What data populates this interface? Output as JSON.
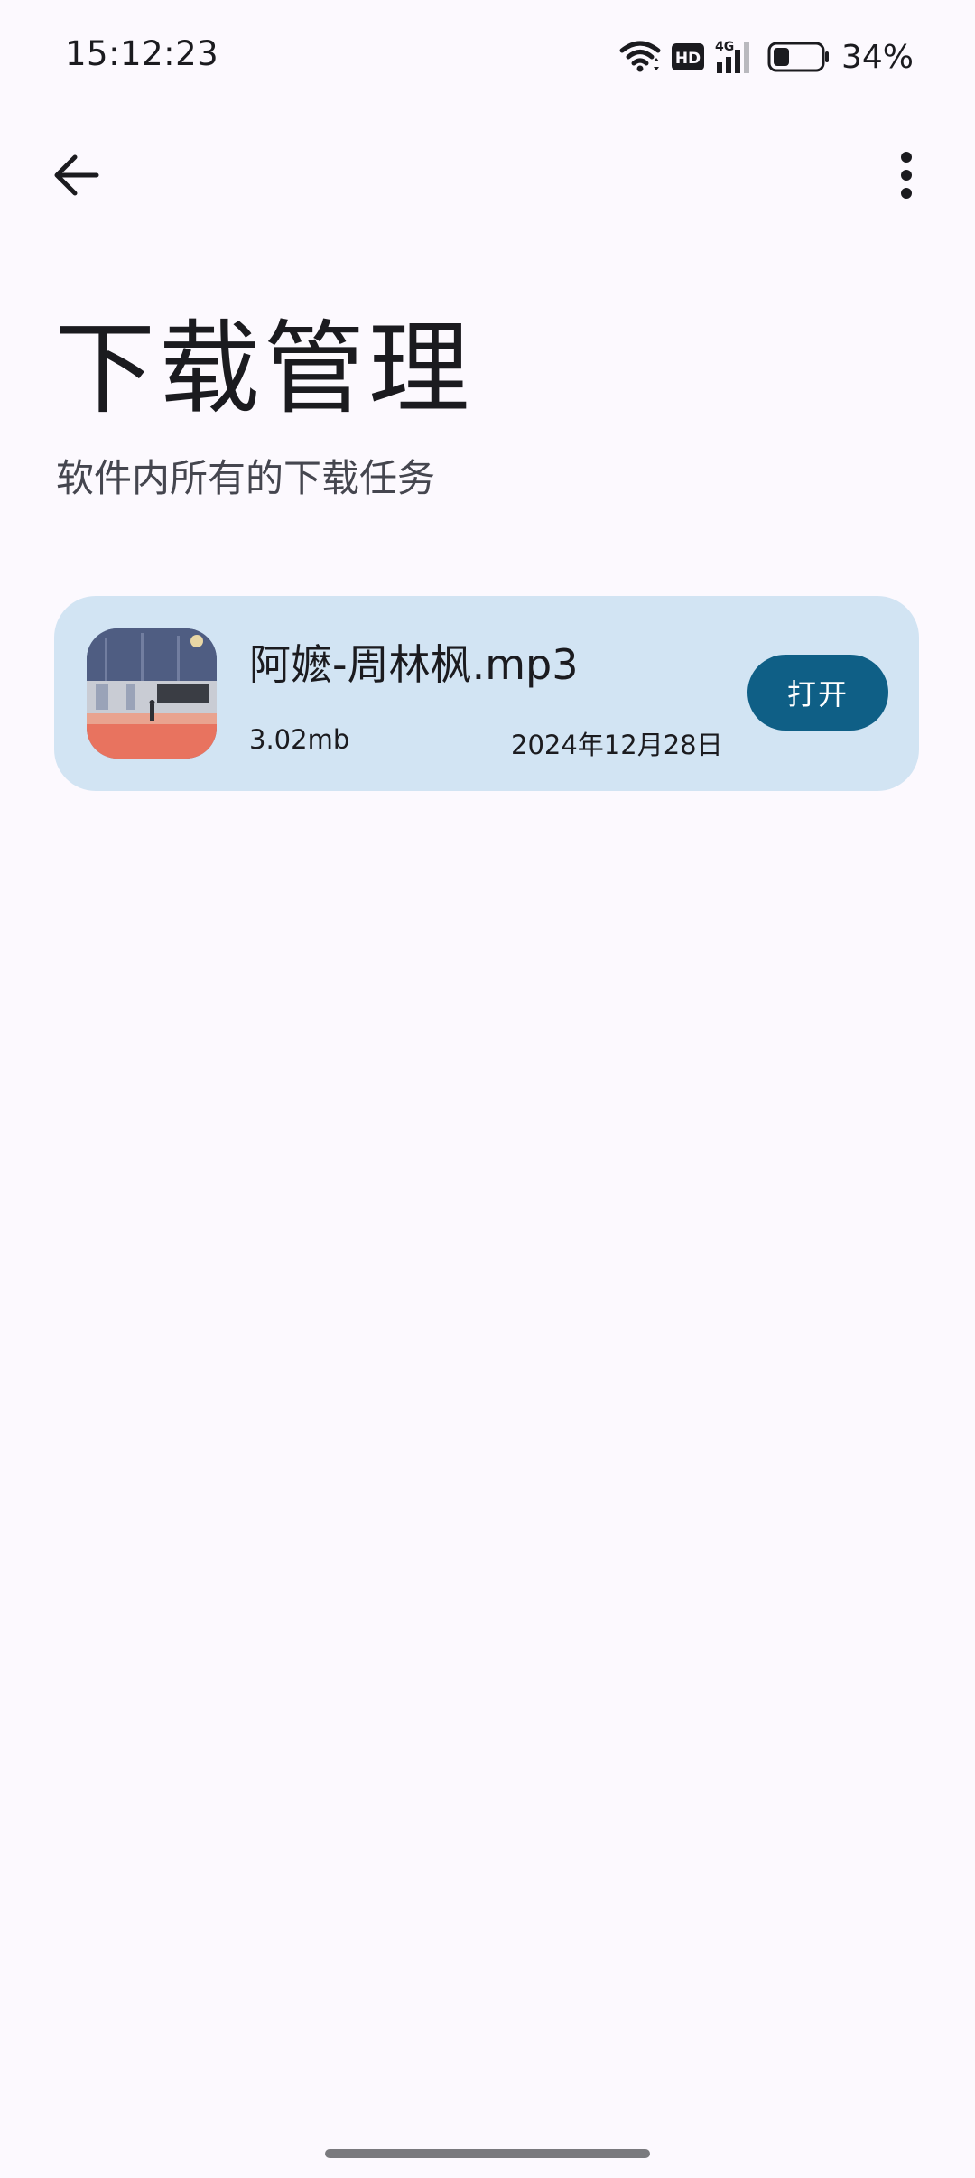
{
  "status_bar": {
    "time": "15:12:23",
    "battery_percent": "34%",
    "battery_level": 0.34,
    "icons": [
      "wifi-icon",
      "hd-icon",
      "4g-signal-icon",
      "battery-icon"
    ],
    "hd_label": "HD",
    "network_label": "4G"
  },
  "app_bar": {
    "back_icon": "arrow-left-icon",
    "more_icon": "more-vertical-icon"
  },
  "header": {
    "title": "下载管理",
    "subtitle": "软件内所有的下载任务"
  },
  "downloads": [
    {
      "file_name": "阿嬷-周林枫.mp3",
      "size": "3.02mb",
      "date": "2024年12月28日",
      "action_label": "打开",
      "cover_icon": "album-cover-image"
    }
  ],
  "colors": {
    "background": "#fcf9fe",
    "card": "#d2e4f3",
    "button": "#0f5f86",
    "text": "#1b1b1f"
  }
}
